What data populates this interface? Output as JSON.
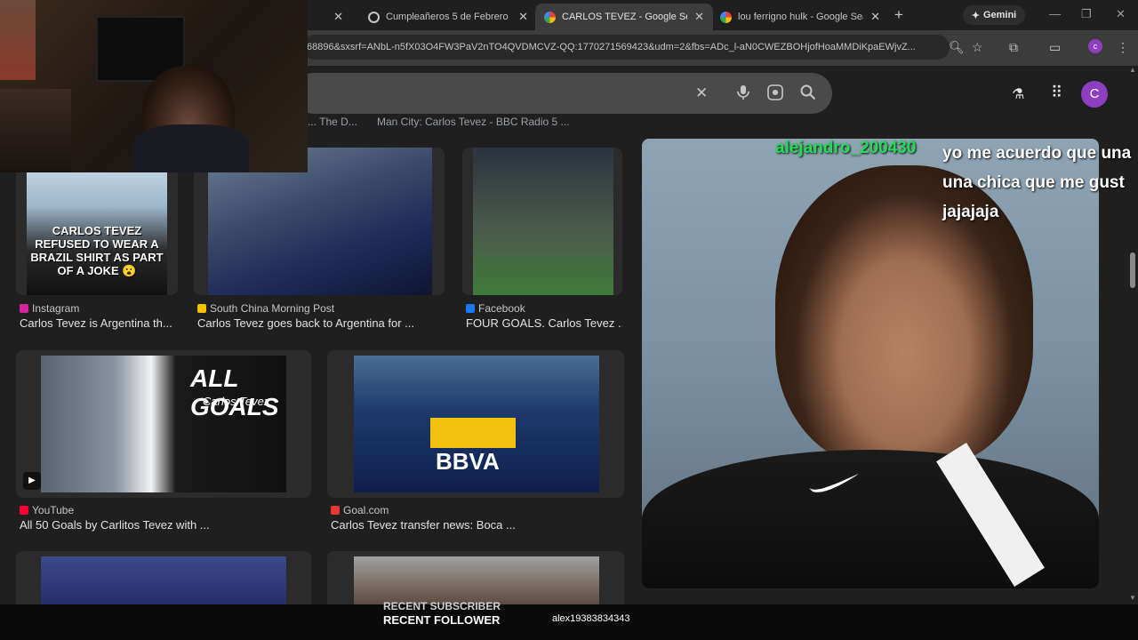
{
  "tabs": [
    {
      "title": "Cumpleañeros 5 de Febrero",
      "favicon_color": "#c4c7c5"
    },
    {
      "title": "CARLOS TEVEZ - Google Search",
      "favicon_color": "#4285f4"
    },
    {
      "title": "lou ferrigno hulk - Google Search",
      "favicon_color": "#4285f4"
    }
  ],
  "new_tab_icon": "+",
  "gemini_label": "Gemini",
  "window_controls": {
    "minimize": "—",
    "maximize": "❐",
    "close": "✕"
  },
  "address": {
    "url": "68896&sxsrf=ANbL-n5fX03O4FW3PaV2nTO4QVDMCVZ-QQ:1770271569423&udm=2&fbs=ADc_l-aN0CWEZBOHjofHoaMMDiKpaEWjvZ..."
  },
  "toolbar": {
    "profile_initial": "c"
  },
  "search": {
    "clear_icon": "✕",
    "mic_icon": "mic-icon",
    "lens_icon": "lens-icon",
    "search_icon": "search-icon"
  },
  "header": {
    "labs_icon": "flask-icon",
    "apps_icon": "grid-icon",
    "avatar_initial": "C"
  },
  "previous_row": [
    "... The D...",
    "Man City: Carlos Tevez - BBC Radio 5 ..."
  ],
  "results": [
    {
      "source": "Instagram",
      "source_color": "#d6249f",
      "caption": "Carlos Tevez is Argentina th...",
      "image_text": "CARLOS TEVEZ REFUSED TO WEAR A BRAZIL SHIRT AS PART OF A JOKE 😮"
    },
    {
      "source": "South China Morning Post",
      "source_color": "#f2c100",
      "caption": "Carlos Tevez goes back to Argentina for ..."
    },
    {
      "source": "Facebook",
      "source_color": "#1877f2",
      "caption": "FOUR GOALS. Carlos Tevez ..."
    },
    {
      "source": "YouTube",
      "source_color": "#ff0033",
      "caption": "All 50 Goals by Carlitos Tevez with ...",
      "image_title": "ALL GOALS",
      "image_subtitle": "Carlos Tevez"
    },
    {
      "source": "Goal.com",
      "source_color": "#e53935",
      "caption": "Carlos Tevez transfer news: Boca ...",
      "image_text": "BBVA"
    }
  ],
  "chat": {
    "username": "alejandro_200430",
    "message": "yo me acuerdo que una\nuna chica que me gust\njajajaja"
  },
  "overlay": {
    "subscriber_label": "RECENT SUBSCRIBER",
    "follower_label": "RECENT FOLLOWER",
    "follower_name": "alex19383834343"
  }
}
